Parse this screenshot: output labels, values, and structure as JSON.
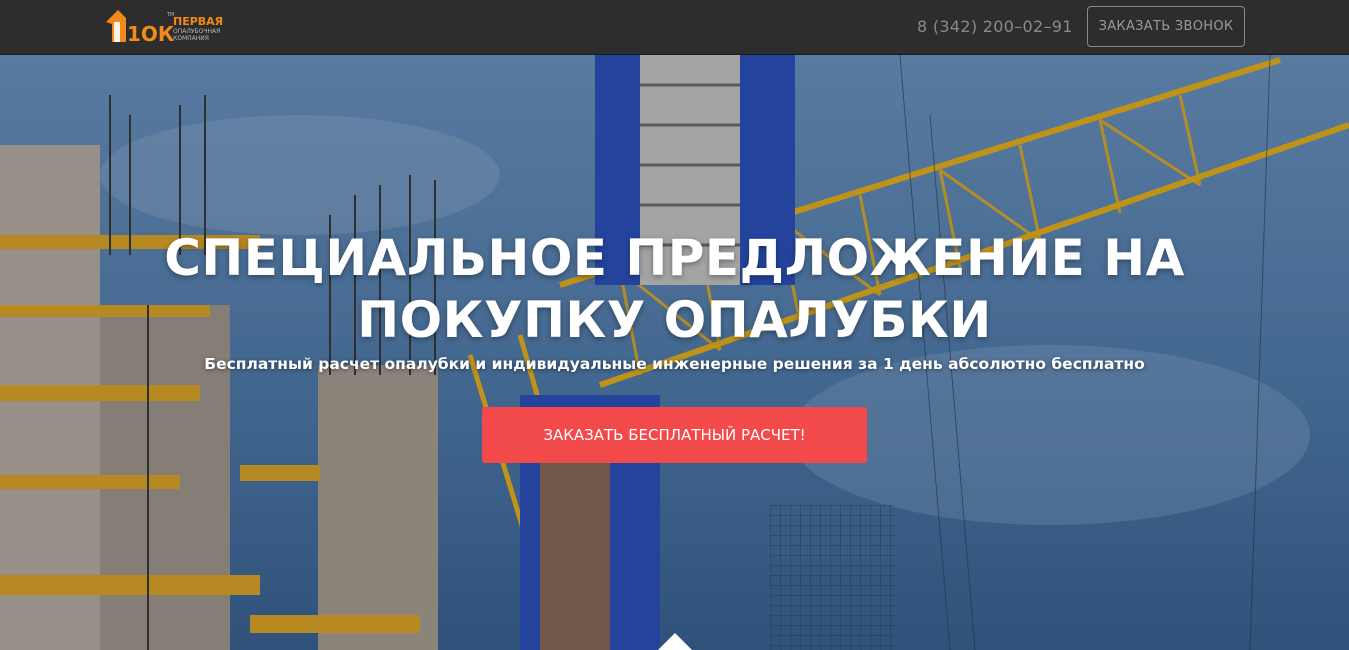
{
  "header": {
    "logo": {
      "mark": "1ОК",
      "tm": "TM",
      "line1": "ПЕРВАЯ",
      "line2": "ОПАЛУБОЧНАЯ",
      "line3": "КОМПАНИЯ"
    },
    "phone": "8 (342) 200–02–91",
    "call_button": "ЗАКАЗАТЬ ЗВОНОК"
  },
  "hero": {
    "title_line1": "СПЕЦИАЛЬНОЕ ПРЕДЛОЖЕНИЕ НА",
    "title_line2": "ПОКУПКУ ОПАЛУБКИ",
    "subtitle": "Бесплатный расчет опалубки и индивидуальные инженерные решения за 1 день абсолютно бесплатно",
    "cta_button": "ЗАКАЗАТЬ БЕСПЛАТНЫЙ РАСЧЕТ!",
    "background_icon": "construction-site-image",
    "scroll_icon": "scroll-down-icon"
  },
  "colors": {
    "header_bg": "#2d2d2d",
    "logo_orange": "#f08a1a",
    "cta_red": "#f24a4a",
    "sky": "#5a86b4",
    "crane_yellow": "#e9b21e",
    "formwork_blue": "#2b52c0"
  }
}
